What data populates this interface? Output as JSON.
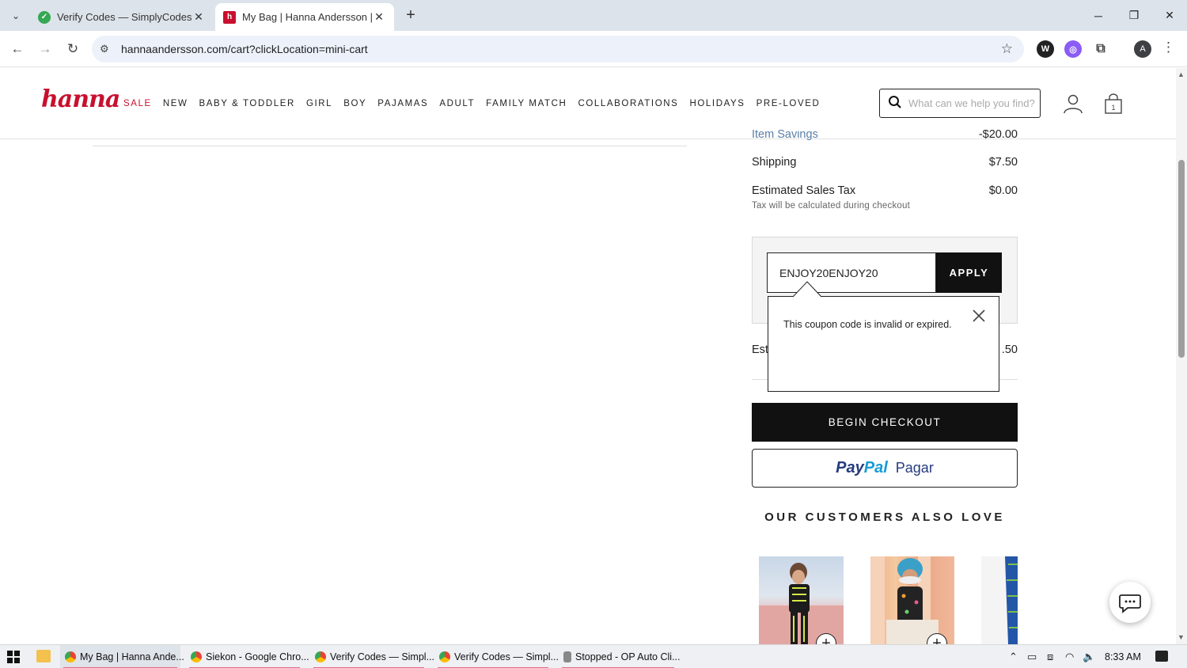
{
  "browser": {
    "tabs": [
      {
        "title": "Verify Codes — SimplyCodes",
        "active": false,
        "favicon_color": "#34a853"
      },
      {
        "title": "My Bag | Hanna Andersson | Ha",
        "active": true,
        "favicon_color": "#c8102e"
      }
    ],
    "url": "hannaandersson.com/cart?clickLocation=mini-cart",
    "profile_initial": "A"
  },
  "site": {
    "logo": "hanna",
    "nav": [
      "SALE",
      "NEW",
      "BABY & TODDLER",
      "GIRL",
      "BOY",
      "PAJAMAS",
      "ADULT",
      "FAMILY MATCH",
      "COLLABORATIONS",
      "HOLIDAYS",
      "PRE-LOVED"
    ],
    "search_placeholder": "What can we help you find?",
    "bag_count": "1",
    "accent_color": "#c8102e"
  },
  "summary": {
    "item_savings_label": "Item Savings",
    "item_savings_value": "-$20.00",
    "shipping_label": "Shipping",
    "shipping_value": "$7.50",
    "tax_label": "Estimated Sales Tax",
    "tax_value": "$0.00",
    "tax_note": "Tax will be calculated during checkout",
    "estimated_label": "Esti",
    "estimated_value": ".50"
  },
  "coupon": {
    "value": "ENJOY20ENJOY20",
    "apply_label": "APPLY",
    "error_message": "This coupon code is invalid or expired."
  },
  "checkout_label": "BEGIN CHECKOUT",
  "paypal": {
    "brand_a": "Pay",
    "brand_b": "Pal",
    "label": "Pagar"
  },
  "also_love_title": "OUR CUSTOMERS ALSO LOVE",
  "taskbar": {
    "items": [
      {
        "label": "My Bag | Hanna Ande...",
        "active": true
      },
      {
        "label": "Siekon - Google Chro...",
        "active": false
      },
      {
        "label": "Verify Codes — Simpl...",
        "active": false
      },
      {
        "label": "Verify Codes — Simpl...",
        "active": false
      },
      {
        "label": "Stopped - OP Auto Cli...",
        "active": false
      }
    ],
    "clock": "8:33 AM"
  }
}
